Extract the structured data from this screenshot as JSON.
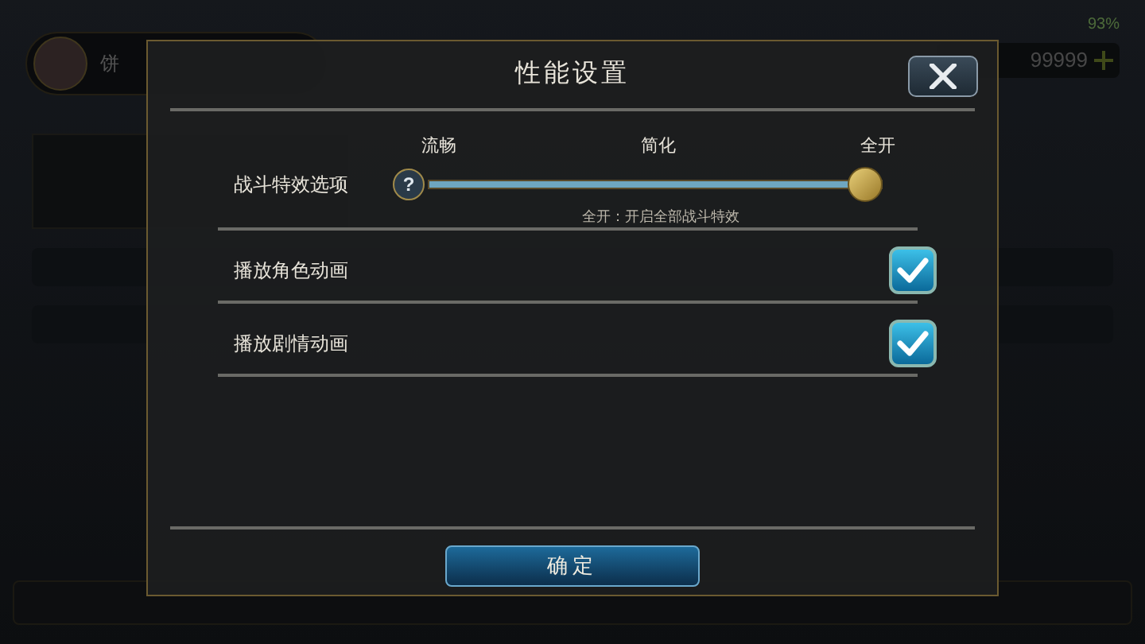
{
  "background": {
    "player_name": "饼",
    "currency": "99999",
    "battery": "93%"
  },
  "dialog": {
    "title": "性能设置",
    "options": [
      {
        "kind": "slider",
        "label": "战斗特效选项",
        "help": "?",
        "stops": [
          "流畅",
          "简化",
          "全开"
        ],
        "level": 1,
        "hint": "全开：开启全部战斗特效"
      },
      {
        "kind": "checkbox",
        "label": "播放角色动画",
        "checked": true
      },
      {
        "kind": "checkbox",
        "label": "播放剧情动画",
        "checked": true
      }
    ],
    "confirm": "确定"
  }
}
